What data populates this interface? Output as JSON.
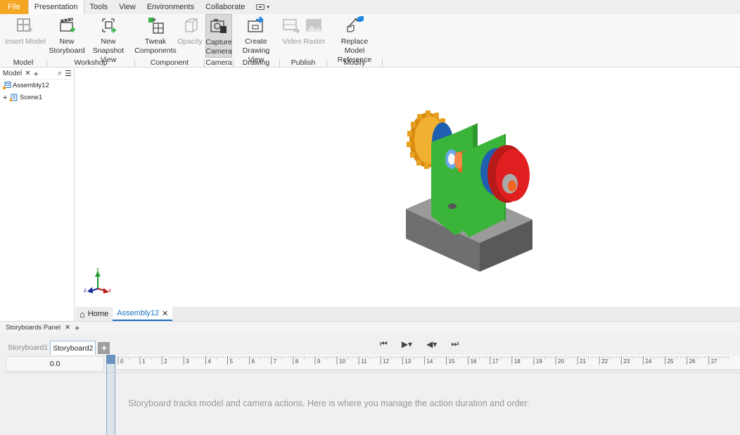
{
  "menubar": {
    "items": [
      {
        "label": "File",
        "name": "menu-file"
      },
      {
        "label": "Presentation",
        "name": "menu-presentation"
      },
      {
        "label": "Tools",
        "name": "menu-tools"
      },
      {
        "label": "View",
        "name": "menu-view"
      },
      {
        "label": "Environments",
        "name": "menu-environments"
      },
      {
        "label": "Collaborate",
        "name": "menu-collaborate"
      }
    ]
  },
  "ribbon": {
    "buttons": {
      "insert_model": "Insert Model",
      "new_storyboard": [
        "New",
        "Storyboard"
      ],
      "new_snapshot": [
        "New",
        "Snapshot View"
      ],
      "tweak": [
        "Tweak",
        "Components"
      ],
      "opacity": "Opacity",
      "capture_camera": [
        "Capture",
        "Camera"
      ],
      "create_drawing": [
        "Create",
        "Drawing View"
      ],
      "video": "Video",
      "raster": "Raster",
      "replace_model": [
        "Replace",
        "Model Reference"
      ]
    },
    "groups": {
      "model": "Model",
      "workshop": "Workshop",
      "component": "Component",
      "camera": "Camera",
      "drawing": "Drawing",
      "publish": "Publish",
      "modify": "Modify"
    },
    "icon_colors": {
      "green": "#38b44a",
      "blue": "#1e88e5",
      "gray": "#8a8a8a"
    }
  },
  "browser": {
    "tab_label": "Model",
    "tree": [
      {
        "label": "Assembly12",
        "expander": ""
      },
      {
        "label": "Scene1",
        "expander": "+"
      }
    ]
  },
  "viewport": {
    "triad": {
      "x": "x",
      "y": "y",
      "z": "z"
    }
  },
  "doc_tabs": {
    "home": "Home",
    "active": "Assembly12"
  },
  "storyboards": {
    "panel_title": "Storyboards Panel",
    "tabs": [
      "Storyboard1",
      "Storyboard2"
    ],
    "active_tab": "Storyboard2",
    "add_label": "+",
    "time": "0.0",
    "ruler_ticks": [
      "0",
      "1",
      "2",
      "3",
      "4",
      "5",
      "6",
      "7",
      "8",
      "9",
      "10",
      "11",
      "12",
      "13",
      "14",
      "15",
      "16",
      "17",
      "18",
      "19",
      "20",
      "21",
      "22",
      "23",
      "24",
      "25",
      "26",
      "27"
    ],
    "message": "Storyboard tracks model and camera actions. Here is where you manage the action duration and order."
  },
  "colors": {
    "accent_blue": "#1a6fbf",
    "file_orange": "#f5a623",
    "part_green": "#3ab53a",
    "part_red": "#e02020",
    "part_orange": "#f26522",
    "gear_gold": "#e8a020",
    "base_gray": "#777777"
  }
}
